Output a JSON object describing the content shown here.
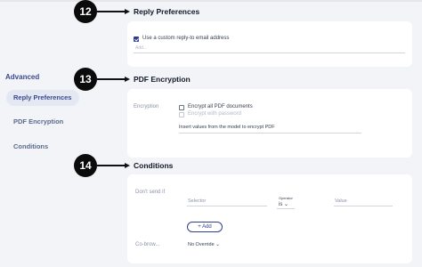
{
  "sidebar": {
    "title": "Advanced",
    "items": [
      {
        "label": "Reply Preferences",
        "active": true
      },
      {
        "label": "PDF Encryption",
        "active": false
      },
      {
        "label": "Conditions",
        "active": false
      }
    ]
  },
  "markers": {
    "reply": "12",
    "pdf": "13",
    "conditions": "14"
  },
  "reply_preferences": {
    "title": "Reply Preferences",
    "checkbox_label": "Use a custom reply-to email address",
    "checkbox_checked": true,
    "input_placeholder": "Add..."
  },
  "pdf_encryption": {
    "title": "PDF Encryption",
    "label": "Encryption",
    "option_all": "Encrypt all PDF documents",
    "option_password": "Encrypt with password",
    "model_field_placeholder": "Insert values from the model to encrypt PDF"
  },
  "conditions": {
    "title": "Conditions",
    "dont_send_label": "Don't send if",
    "selector_placeholder": "Selector",
    "operator_label": "Operator",
    "operator_value": "is",
    "value_placeholder": "Value",
    "add_button": "Add",
    "cobrow_label": "Co-brow...",
    "override_value": "No Override"
  },
  "colors": {
    "accent": "#2f3f8f",
    "background": "#f3f4f8",
    "marker": "#0b0b0b"
  }
}
